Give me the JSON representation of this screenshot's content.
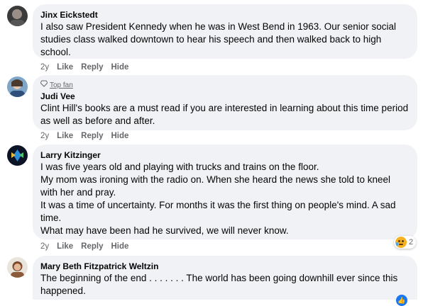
{
  "comments": [
    {
      "author": "Jinx Eickstedt",
      "badge": "",
      "lines": [
        "I also saw President Kennedy when he was in West Bend in 1963. Our senior social studies class walked downtown to hear his speech and then walked back to high school."
      ],
      "time": "2y",
      "like_label": "Like",
      "reply_label": "Reply",
      "hide_label": "Hide",
      "reaction_count": ""
    },
    {
      "author": "Judi Vee",
      "badge": "Top fan",
      "lines": [
        "Clint Hill's books are a must read if you are interested in learning about this time period as well as before and after."
      ],
      "time": "2y",
      "like_label": "Like",
      "reply_label": "Reply",
      "hide_label": "Hide",
      "reaction_count": ""
    },
    {
      "author": "Larry Kitzinger",
      "badge": "",
      "lines": [
        "I was five years old and playing with trucks and trains on the floor.",
        "My mom was ironing with the radio on. When she heard the news she told to kneel with her and pray.",
        "It was a time of uncertainty. For months it was the first thing on people's mind. A sad time.",
        "What may have been had he survived, we will never know."
      ],
      "time": "2y",
      "like_label": "Like",
      "reply_label": "Reply",
      "hide_label": "Hide",
      "reaction_count": "2"
    },
    {
      "author": "Mary Beth Fitzpatrick Weltzin",
      "badge": "",
      "lines": [
        "The beginning of the end . . . . . . . The world has been going downhill ever since this happened."
      ],
      "time": "",
      "like_label": "",
      "reply_label": "",
      "hide_label": "",
      "reaction_count": ""
    }
  ]
}
